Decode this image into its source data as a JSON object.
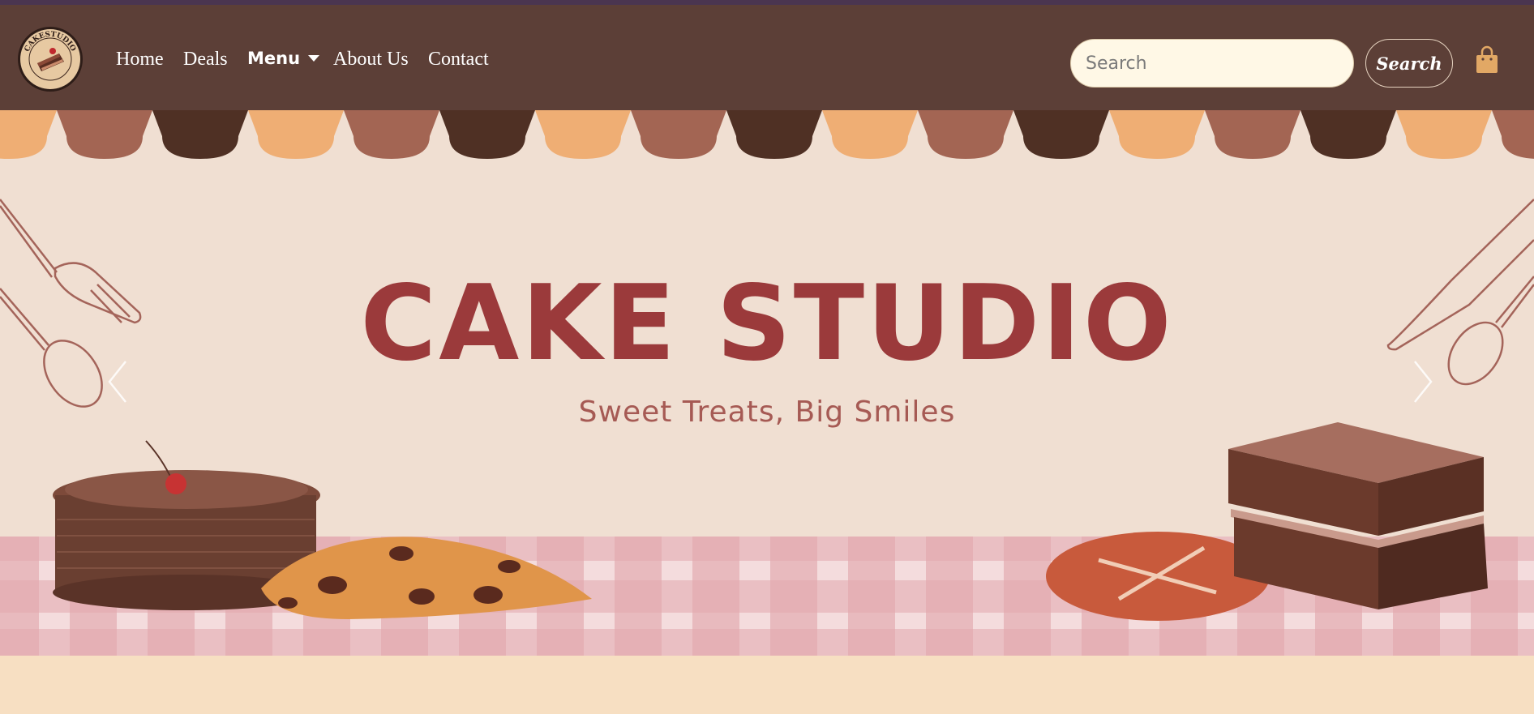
{
  "brand": {
    "logo_name": "CAKESTUDIO",
    "logo_tagline": "Sweet Treats, Big Smiles"
  },
  "nav": {
    "links": [
      {
        "label": "Home"
      },
      {
        "label": "Deals"
      },
      {
        "label": "Menu"
      },
      {
        "label": "About Us"
      },
      {
        "label": "Contact"
      }
    ]
  },
  "search": {
    "placeholder": "Search",
    "value": "",
    "button_label": "Search"
  },
  "icons": {
    "cart": "shopping-bag-icon",
    "prev": "chevron-left-icon",
    "next": "chevron-right-icon"
  },
  "hero": {
    "title": "CAKE STUDIO",
    "subtitle": "Sweet Treats, Big Smiles"
  },
  "colors": {
    "navbar": "#5c3f37",
    "hero_bg": "#f0dfd2",
    "title": "#9b3a3b",
    "page_bg": "#f7dfc2",
    "awning": [
      "#efae74",
      "#a36553",
      "#4f3024"
    ]
  }
}
